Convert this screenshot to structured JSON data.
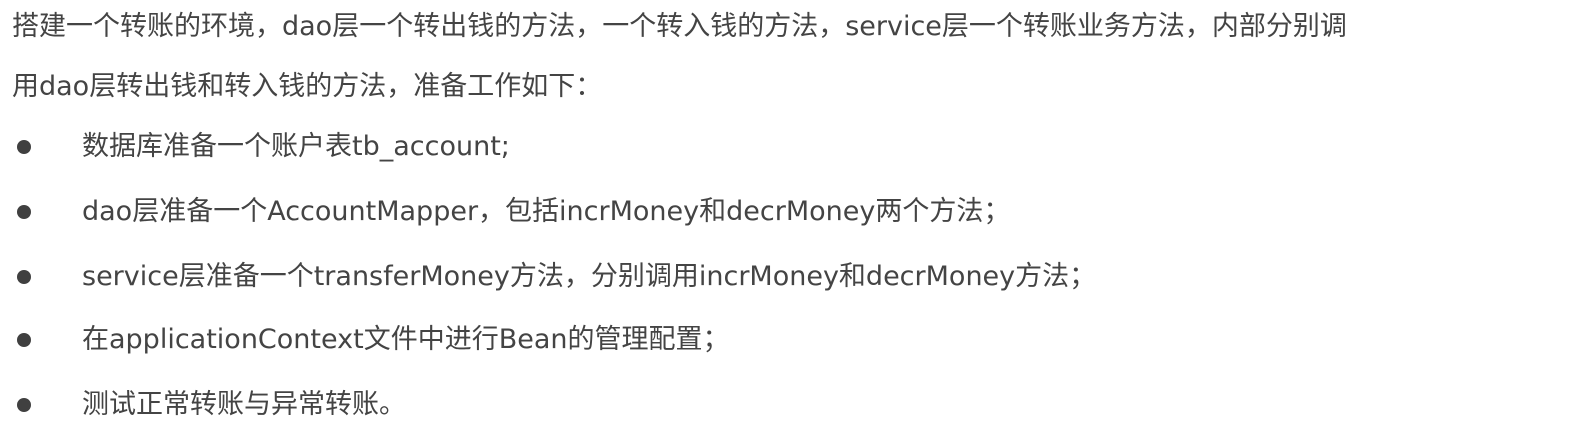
{
  "intro": {
    "line1": "搭建一个转账的环境，dao层一个转出钱的方法，一个转入钱的方法，service层一个转账业务方法，内部分别调",
    "line2": "用dao层转出钱和转入钱的方法，准备工作如下："
  },
  "bullets": [
    {
      "text": "数据库准备一个账户表tb_account;"
    },
    {
      "text": "dao层准备一个AccountMapper，包括incrMoney和decrMoney两个方法；"
    },
    {
      "text": "service层准备一个transferMoney方法，分别调用incrMoney和decrMoney方法；"
    },
    {
      "text": "在applicationContext文件中进行Bean的管理配置；"
    },
    {
      "text": "测试正常转账与异常转账。"
    }
  ],
  "colors": {
    "text": "#444444",
    "bullet": "#404040",
    "background": "#ffffff"
  }
}
